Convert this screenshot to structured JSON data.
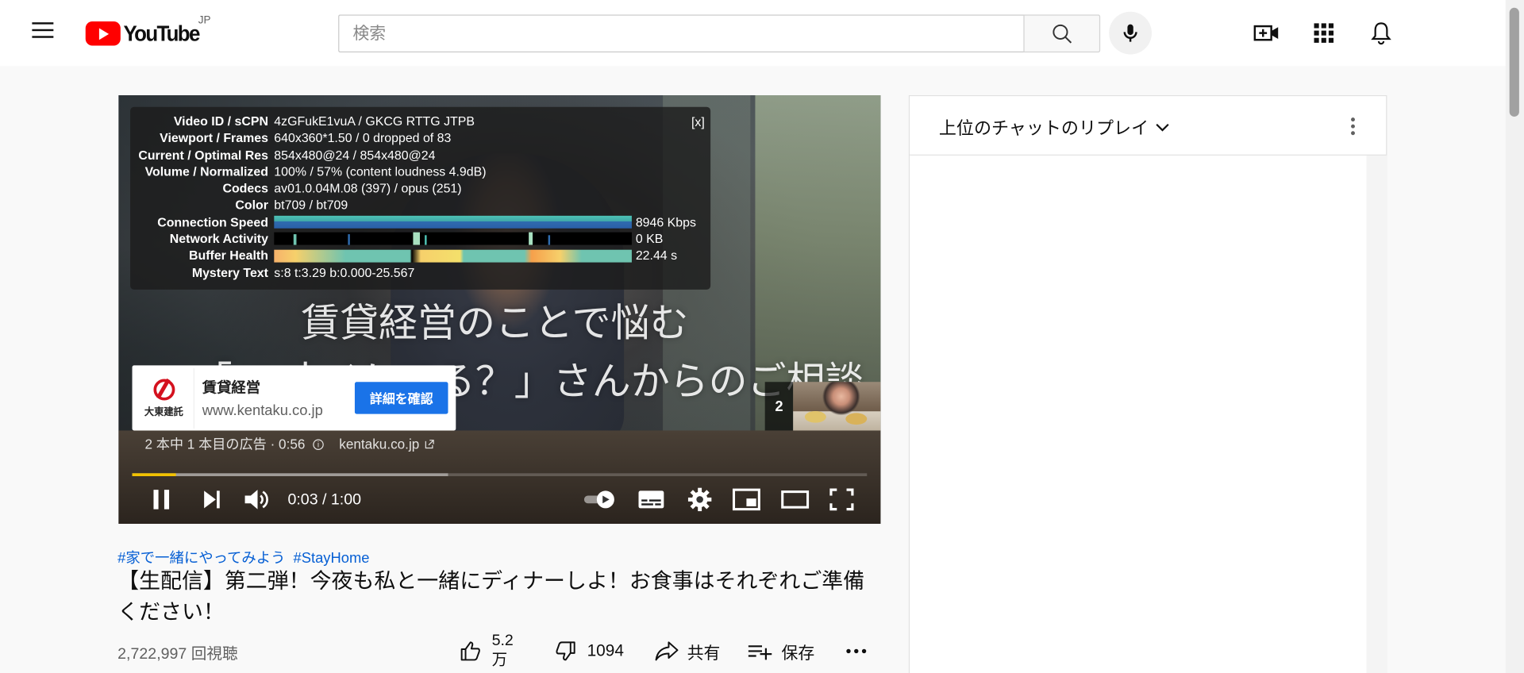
{
  "header": {
    "logo_text": "YouTube",
    "country_code": "JP",
    "search_placeholder": "検索"
  },
  "stats": {
    "close_label": "[x]",
    "rows": [
      {
        "label": "Video ID / sCPN",
        "value": "4zGFukE1vuA / GKCG RTTG JTPB"
      },
      {
        "label": "Viewport / Frames",
        "value": "640x360*1.50 / 0 dropped of 83"
      },
      {
        "label": "Current / Optimal Res",
        "value": "854x480@24 / 854x480@24"
      },
      {
        "label": "Volume / Normalized",
        "value": "100% / 57% (content loudness 4.9dB)"
      },
      {
        "label": "Codecs",
        "value": "av01.0.04M.08 (397) / opus (251)"
      },
      {
        "label": "Color",
        "value": "bt709 / bt709"
      },
      {
        "label": "Connection Speed",
        "value": "8946 Kbps"
      },
      {
        "label": "Network Activity",
        "value": "0 KB"
      },
      {
        "label": "Buffer Health",
        "value": "22.44 s"
      },
      {
        "label": "Mystery Text",
        "value": "s:8 t:3.29 b:0.000-25.567"
      }
    ]
  },
  "video": {
    "overlay_line1": "賃貸経営のことで悩む",
    "overlay_line2": "「45 才イケてる？」さんからのご相談",
    "time_display": "0:03 / 1:00",
    "progress_played_fraction": 0.06,
    "progress_loaded_fraction": 0.43
  },
  "ad": {
    "logo_text": "大東建託",
    "name": "賃貸経営",
    "url": "www.kentaku.co.jp",
    "cta": "詳細を確認",
    "info_text": "2 本中 1 本目の広告 · 0:56",
    "info_link": "kentaku.co.jp",
    "next_count": "2"
  },
  "below": {
    "hashtag1": "#家で一緒にやってみよう",
    "hashtag2": "#StayHome",
    "title": "【生配信】第二弾！今夜も私と一緒にディナーしよ！お食事はそれぞれご準備ください！",
    "views": "2,722,997 回視聴",
    "like_count_line1": "5.2",
    "like_count_line2": "万",
    "dislike_count": "1094",
    "share_label": "共有",
    "save_label": "保存"
  },
  "chat": {
    "title": "上位のチャットのリプレイ"
  },
  "colors": {
    "brand_red": "#ff0000",
    "link_blue": "#065fd4",
    "cta_blue": "#1a73e8",
    "progress_yellow": "#f2c200"
  },
  "icons": [
    "menu-icon",
    "youtube-logo-icon",
    "search-icon",
    "mic-icon",
    "create-video-icon",
    "apps-grid-icon",
    "bell-icon",
    "pause-icon",
    "next-icon",
    "volume-icon",
    "autoplay-toggle-icon",
    "subtitles-icon",
    "settings-gear-icon",
    "miniplayer-icon",
    "theater-mode-icon",
    "fullscreen-icon",
    "info-icon",
    "external-link-icon",
    "like-icon",
    "dislike-icon",
    "share-icon",
    "save-playlist-icon",
    "more-horizontal-icon",
    "chevron-down-icon",
    "more-vertical-icon"
  ]
}
